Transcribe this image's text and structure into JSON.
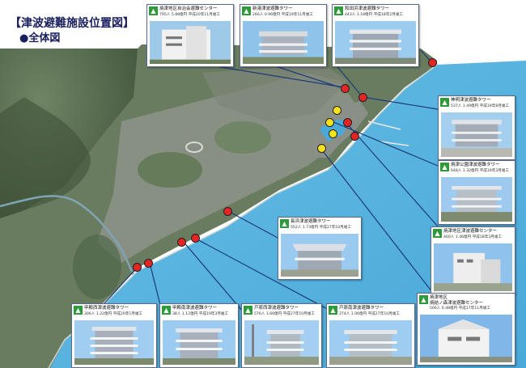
{
  "title": "【津波避難施設位置図】",
  "subtitle": "●全体図",
  "cards": [
    {
      "id": "yaizu-center",
      "name": "焼津地区自治会避難センター",
      "info": "795人  5.88億円  平成20年11月竣工",
      "style": "white"
    },
    {
      "id": "shinminato",
      "name": "新港津波避難タワー",
      "info": "266人  0.96億円  平成19年11月竣工",
      "style": "tower"
    },
    {
      "id": "wadahama",
      "name": "和田浜津波避難タワー",
      "info": "443人  1.18億円  平成18年2月竣工",
      "style": "tower"
    },
    {
      "id": "jinmei",
      "name": "神明津波避難タワー",
      "info": "537人  1.49億円  平成19年8月竣工",
      "style": "tower"
    },
    {
      "id": "yaizu-park",
      "name": "焼津公園津波避難タワー",
      "info": "648人  1.32億円  平成19年3月竣工",
      "style": "steel"
    },
    {
      "id": "yaizu-port",
      "name": "焼津地区津波避難センター",
      "info": "460人  1.46億円  平成18年3月竣工",
      "style": "white"
    },
    {
      "id": "yaizu-fishing",
      "name": "焼津地区\n焼結ノ森津波避難センター",
      "info": "506人  6.48億円  平成17年11月竣工",
      "style": "white"
    },
    {
      "id": "nagahama",
      "name": "長浜津波避難タワー",
      "info": "552人  1.73億円  平成27年10月竣工",
      "style": "tower"
    },
    {
      "id": "higashi-kotoku",
      "name": "甲殿西津波避難タワー",
      "info": "306人  1.22億円  平成20年1月竣工",
      "style": "tower"
    },
    {
      "id": "kotoku-minami",
      "name": "甲殿南津波避難タワー",
      "info": "38人  1.12億円  平成19年3月竣工",
      "style": "tower"
    },
    {
      "id": "todo-west",
      "name": "戸原西津波避難タワー",
      "info": "576人  1.66億円  平成27年10月竣工",
      "style": "tower"
    },
    {
      "id": "todo-south",
      "name": "戸原南津波避難タワー",
      "info": "274人  1.06億円  平成27年10月竣工",
      "style": "steel"
    }
  ],
  "markers": {
    "red": [
      "",
      "",
      "",
      "",
      "",
      "",
      "",
      "",
      "",
      ""
    ],
    "yellow": [
      "",
      "",
      "",
      ""
    ]
  },
  "colors": {
    "sea": "#59b8e2",
    "land": "#5d7254",
    "city": "#8a8f8a",
    "card_border": "#5a6a8a",
    "icon": "#2e9a3a",
    "red_pin": "#e52424",
    "yellow_pin": "#f6e21b",
    "title": "#1a1f5e",
    "connector": "#1c3a7a"
  }
}
